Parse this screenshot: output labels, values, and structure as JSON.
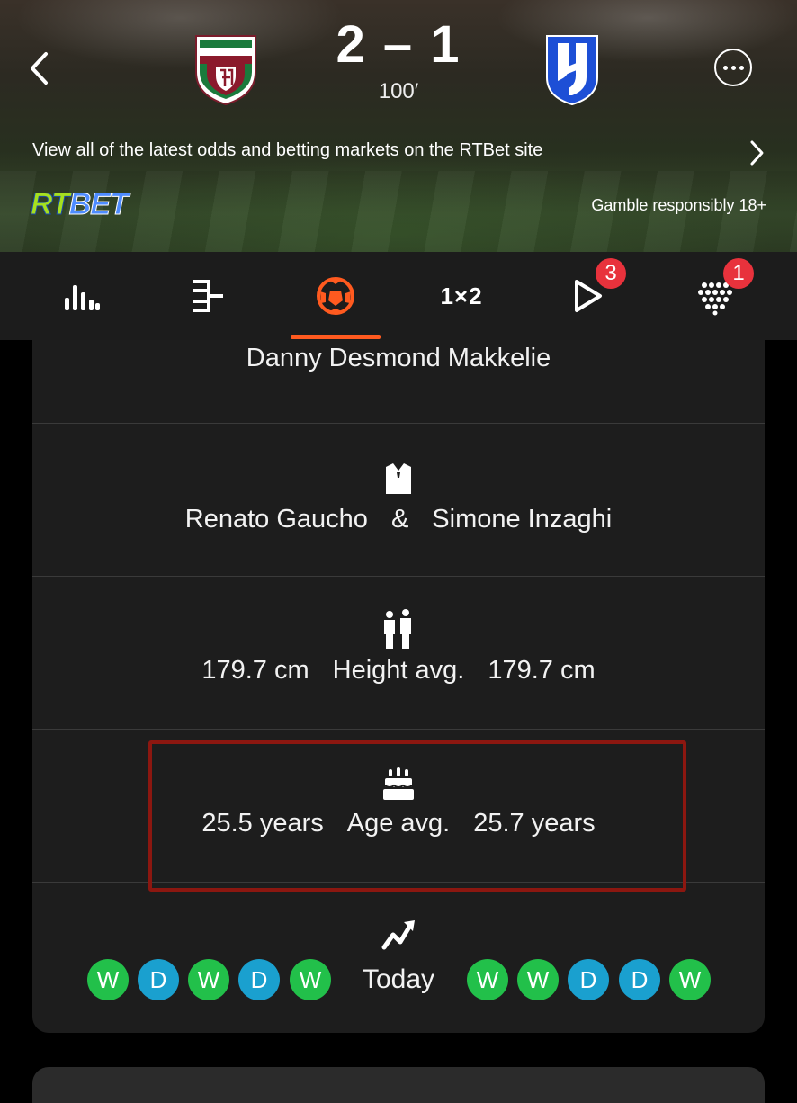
{
  "match": {
    "home_score": "2",
    "score_separator": "–",
    "away_score": "1",
    "minute": "100′"
  },
  "banner": {
    "odds_text": "View all of the latest odds and betting markets on the RTBet site",
    "logo_rt": "RT",
    "logo_bet": "BET",
    "gamble_text": "Gamble responsibly 18+"
  },
  "tabs": {
    "odds_label": "1×2",
    "video_badge": "3",
    "lineups_badge": "1",
    "active_color": "#ff5a1f"
  },
  "details": {
    "referee": "Danny Desmond Makkelie",
    "managers": {
      "home": "Renato Gaucho",
      "separator": "&",
      "away": "Simone Inzaghi"
    },
    "height": {
      "home": "179.7 cm",
      "label": "Height avg.",
      "away": "179.7 cm"
    },
    "age": {
      "home": "25.5 years",
      "label": "Age avg.",
      "away": "25.7 years"
    },
    "form": {
      "home": [
        "W",
        "D",
        "W",
        "D",
        "W"
      ],
      "label": "Today",
      "away": [
        "W",
        "W",
        "D",
        "D",
        "W"
      ]
    }
  },
  "colors": {
    "win": "#22c04a",
    "draw": "#1aa0cf",
    "badge": "#e8323c",
    "highlight_border": "#8c1710"
  }
}
